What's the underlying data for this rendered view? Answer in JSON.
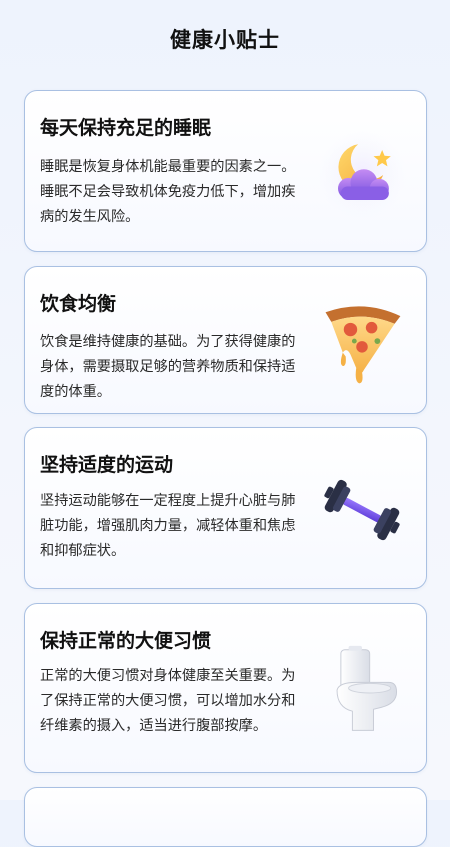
{
  "page": {
    "title": "健康小贴士"
  },
  "tips": [
    {
      "title": "每天保持充足的睡眠",
      "text": "睡眠是恢复身体机能最重要的因素之一。睡眠不足会导致机体免疫力低下，增加疾病的发生风险。",
      "icon": "moon-icon"
    },
    {
      "title": "饮食均衡",
      "text": "饮食是维持健康的基础。为了获得健康的身体，需要摄取足够的营养物质和保持适度的体重。",
      "icon": "pizza-icon"
    },
    {
      "title": "坚持适度的运动",
      "text": "坚持运动能够在一定程度上提升心脏与肺脏功能，增强肌肉力量，减轻体重和焦虑和抑郁症状。",
      "icon": "dumbbell-icon"
    },
    {
      "title": "保持正常的大便习惯",
      "text": "正常的大便习惯对身体健康至关重要。为了保持正常的大便习惯，可以增加水分和纤维素的摄入，适当进行腹部按摩。",
      "icon": "toilet-icon"
    }
  ],
  "colors": {
    "card_border": "#a9c0e2",
    "background": "#eef3fd"
  }
}
